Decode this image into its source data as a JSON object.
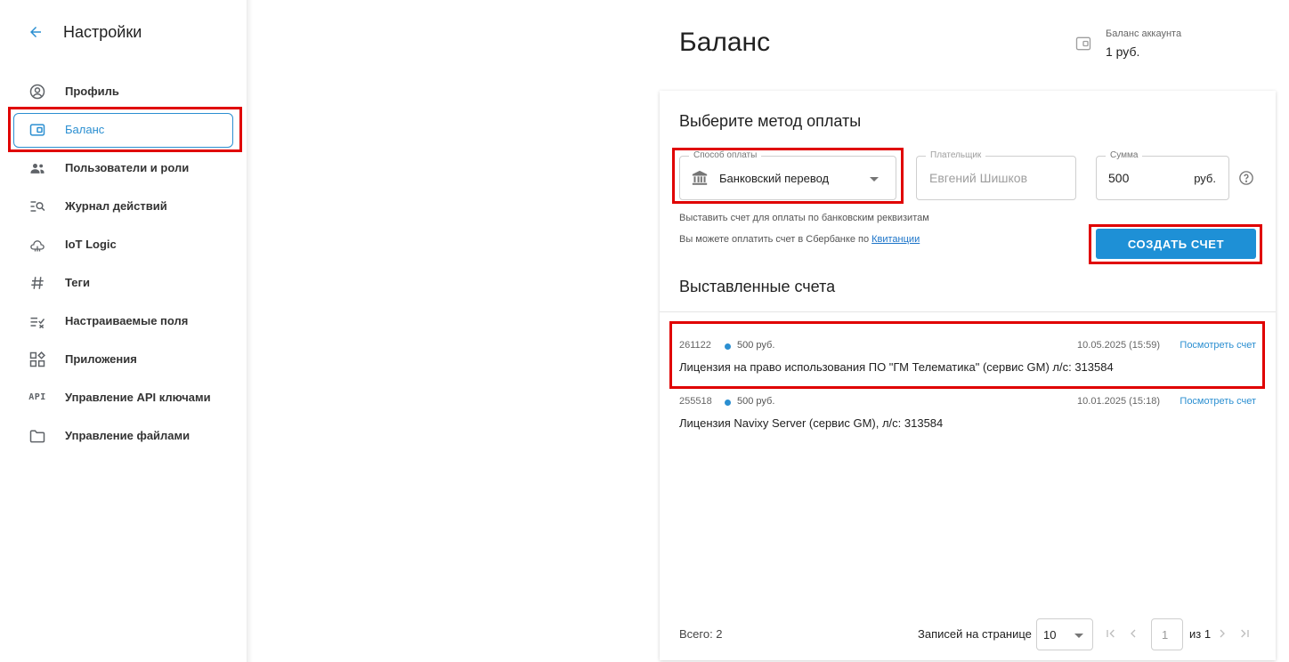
{
  "sidebar": {
    "title": "Настройки",
    "items": [
      {
        "label": "Профиль",
        "icon": "account-circle-icon"
      },
      {
        "label": "Баланс",
        "icon": "wallet-icon"
      },
      {
        "label": "Пользователи и роли",
        "icon": "users-icon"
      },
      {
        "label": "Журнал действий",
        "icon": "log-search-icon"
      },
      {
        "label": "IoT Logic",
        "icon": "iot-logic-icon"
      },
      {
        "label": "Теги",
        "icon": "hashtag-icon"
      },
      {
        "label": "Настраиваемые поля",
        "icon": "custom-fields-icon"
      },
      {
        "label": "Приложения",
        "icon": "apps-icon"
      },
      {
        "label": "Управление API ключами",
        "icon": "api-icon",
        "icon_text": "API"
      },
      {
        "label": "Управление файлами",
        "icon": "folder-icon"
      }
    ]
  },
  "header": {
    "title": "Баланс",
    "balance_label": "Баланс аккаунта",
    "balance_value": "1 руб."
  },
  "payment": {
    "heading": "Выберите метод оплаты",
    "method_label": "Способ оплаты",
    "method_value": "Банковский перевод",
    "payer_label": "Плательщик",
    "payer_placeholder": "Евгений Шишков",
    "amount_label": "Сумма",
    "amount_value": "500",
    "amount_unit": "руб.",
    "helper_1": "Выставить счет для оплаты по банковским реквизитам",
    "helper_2_prefix": "Вы можете оплатить счет в Сбербанке по ",
    "helper_2_link": "Квитанции",
    "create_button": "СОЗДАТЬ СЧЕТ"
  },
  "invoices": {
    "heading": "Выставленные счета",
    "items": [
      {
        "number": "261122",
        "amount": "500 руб.",
        "date": "10.05.2025 (15:59)",
        "link": "Посмотреть счет",
        "description": "Лицензия на право использования ПО \"ГМ Телематика\" (сервис GM) л/с: 313584"
      },
      {
        "number": "255518",
        "amount": "500 руб.",
        "date": "10.01.2025 (15:18)",
        "link": "Посмотреть счет",
        "description": "Лицензия Navixy Server (сервис GM), л/с: 313584"
      }
    ]
  },
  "pagination": {
    "total": "Всего: 2",
    "rows_label": "Записей на странице",
    "rows_value": "10",
    "page_value": "1",
    "of_label": "из 1"
  },
  "colors": {
    "accent": "#2b8fd1",
    "button": "#1e90d6",
    "highlight": "#e00000"
  }
}
